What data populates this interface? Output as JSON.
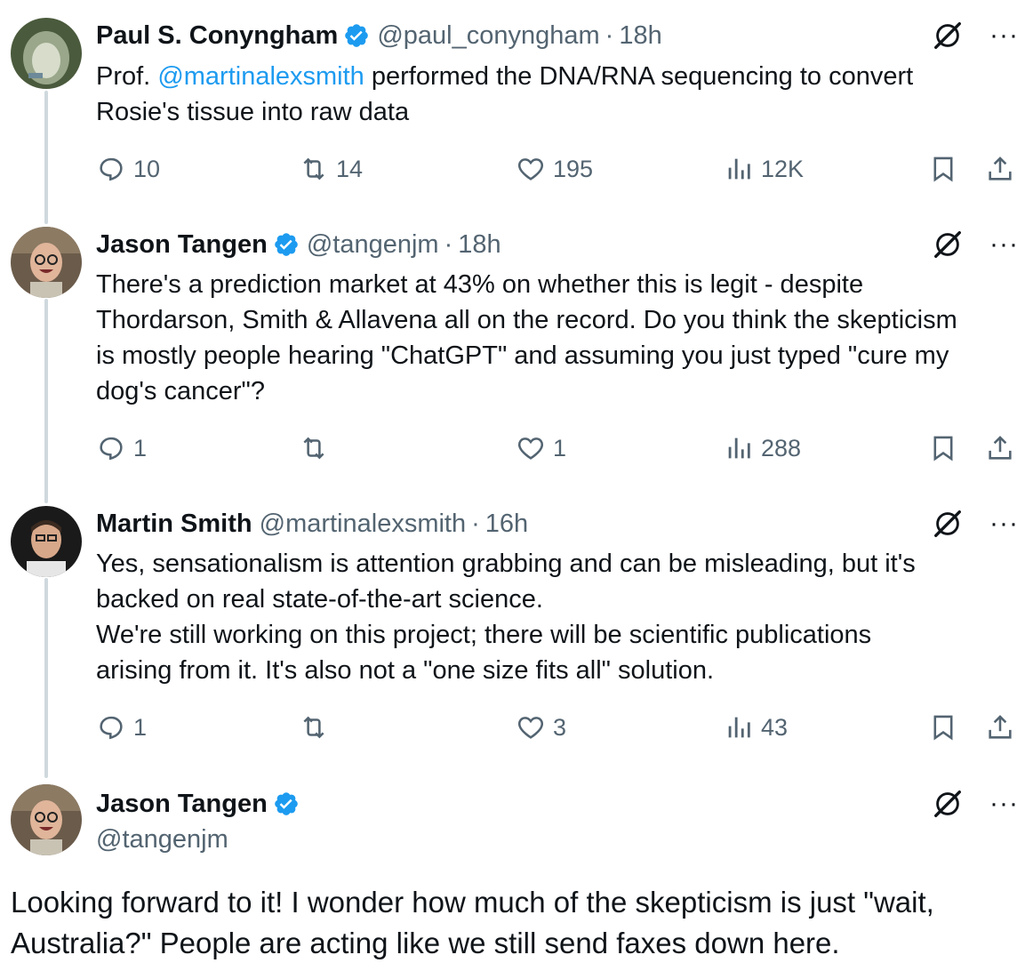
{
  "tweets": [
    {
      "name": "Paul S. Conyngham",
      "verified_icon": "verified-badge-icon",
      "handle": "@paul_conyngham",
      "time": "18h",
      "mention": "@martinalexsmith",
      "text_before": "Prof. ",
      "text_after": " performed the DNA/RNA sequencing to convert\nRosie's tissue into raw data",
      "replies": "10",
      "reposts": "14",
      "likes": "195",
      "views": "12K"
    },
    {
      "name": "Jason Tangen",
      "verified_icon": "verified-badge-icon",
      "handle": "@tangenjm",
      "time": "18h",
      "text": "There's a prediction market at 43% on whether this is legit - despite\nThordarson, Smith & Allavena all on the record. Do you think the skepticism\nis mostly people hearing \"ChatGPT\" and assuming you just typed \"cure my\ndog's cancer\"?",
      "replies": "1",
      "reposts": "",
      "likes": "1",
      "views": "288"
    },
    {
      "name": "Martin Smith",
      "handle": "@martinalexsmith",
      "time": "16h",
      "text": "Yes, sensationalism is attention grabbing and can be misleading, but it's\nbacked on real state-of-the-art science.\nWe're still working on this project; there will be scientific publications\narising from it. It's also not a \"one size fits all\" solution.",
      "replies": "1",
      "reposts": "",
      "likes": "3",
      "views": "43"
    }
  ],
  "main_tweet": {
    "name": "Jason Tangen",
    "verified_icon": "verified-badge-icon",
    "handle": "@tangenjm",
    "text": "Looking forward to it! I wonder how much of the skepticism is just \"wait,\nAustralia?\" People are acting like we still send faxes down here."
  },
  "colors": {
    "accent": "#1d9bf0",
    "secondary_text": "#536471",
    "thread_line": "#cfd9de"
  },
  "icons": [
    "reply-icon",
    "repost-icon",
    "like-icon",
    "views-icon",
    "bookmark-icon",
    "share-icon",
    "grok-icon",
    "more-icon"
  ]
}
